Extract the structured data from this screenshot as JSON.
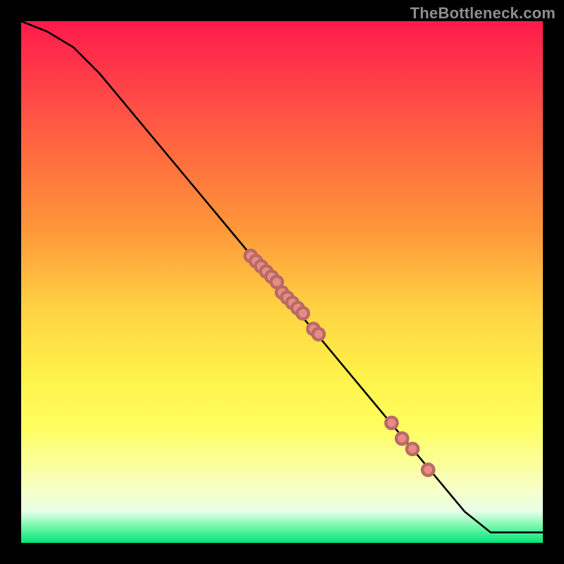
{
  "watermark": "TheBottleneck.com",
  "chart_data": {
    "type": "line",
    "title": "",
    "xlabel": "",
    "ylabel": "",
    "xlim": [
      0,
      100
    ],
    "ylim": [
      0,
      100
    ],
    "series": [
      {
        "name": "curve",
        "x": [
          0,
          5,
          10,
          15,
          20,
          25,
          30,
          35,
          40,
          45,
          50,
          55,
          60,
          65,
          70,
          75,
          80,
          85,
          90,
          92,
          95,
          100
        ],
        "y": [
          100,
          98,
          95,
          90,
          84,
          78,
          72,
          66,
          60,
          54,
          48,
          42,
          36,
          30,
          24,
          18,
          12,
          6,
          2,
          2,
          2,
          2
        ]
      }
    ],
    "markers": {
      "name": "highlighted-points",
      "color": "#e98a84",
      "points": [
        {
          "x": 44,
          "y": 55
        },
        {
          "x": 45,
          "y": 54
        },
        {
          "x": 46,
          "y": 53
        },
        {
          "x": 47,
          "y": 52
        },
        {
          "x": 48,
          "y": 51
        },
        {
          "x": 49,
          "y": 50
        },
        {
          "x": 50,
          "y": 48
        },
        {
          "x": 51,
          "y": 47
        },
        {
          "x": 52,
          "y": 46
        },
        {
          "x": 53,
          "y": 45
        },
        {
          "x": 54,
          "y": 44
        },
        {
          "x": 56,
          "y": 41
        },
        {
          "x": 57,
          "y": 40
        },
        {
          "x": 71,
          "y": 23
        },
        {
          "x": 73,
          "y": 20
        },
        {
          "x": 75,
          "y": 18
        },
        {
          "x": 78,
          "y": 14
        }
      ]
    },
    "background_gradient": {
      "direction": "top-to-bottom",
      "stops": [
        {
          "pos": 0.0,
          "color": "#ff1a4b"
        },
        {
          "pos": 0.25,
          "color": "#ff6a3f"
        },
        {
          "pos": 0.55,
          "color": "#ffd243"
        },
        {
          "pos": 0.78,
          "color": "#ffff60"
        },
        {
          "pos": 0.94,
          "color": "#e8ffe8"
        },
        {
          "pos": 1.0,
          "color": "#00e676"
        }
      ]
    }
  }
}
